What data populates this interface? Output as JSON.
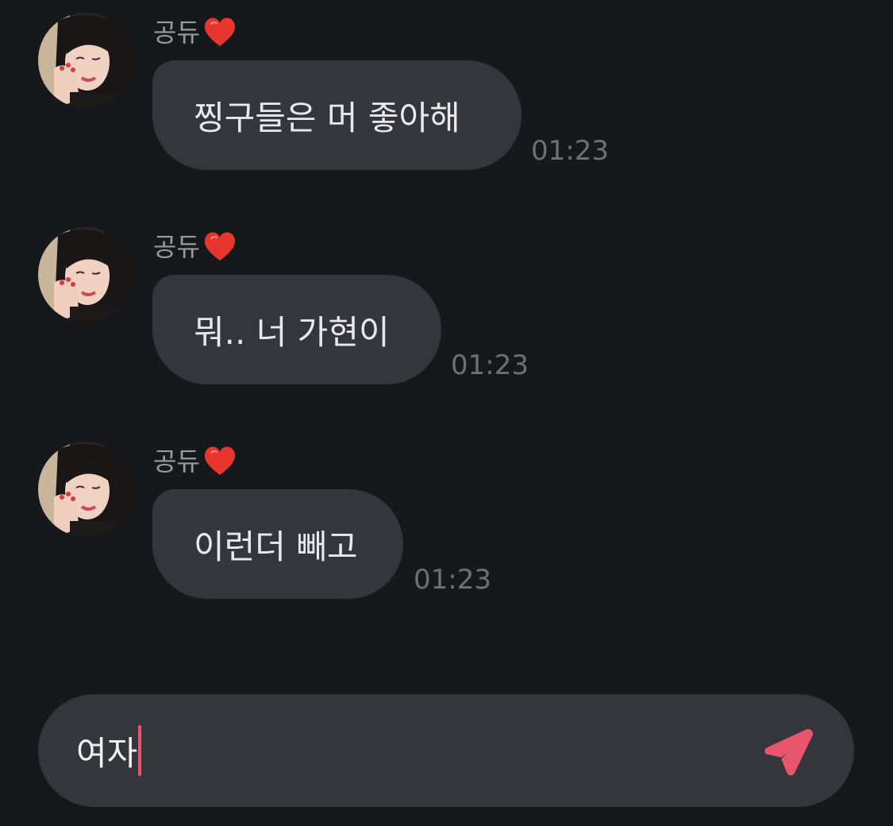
{
  "messages": [
    {
      "sender": "공듀",
      "sender_emoji": "heart",
      "text": "찡구들은 머 좋아해",
      "time": "01:23"
    },
    {
      "sender": "공듀",
      "sender_emoji": "heart",
      "text": "뭐.. 너 가현이",
      "time": "01:23"
    },
    {
      "sender": "공듀",
      "sender_emoji": "heart",
      "text": "이런더 빼고",
      "time": "01:23"
    }
  ],
  "composer": {
    "value": "여자",
    "send_icon": "paper-plane-icon"
  },
  "colors": {
    "background": "#17181c",
    "bubble": "#35363c",
    "accent": "#e9556c",
    "heart": "#e8352e"
  }
}
